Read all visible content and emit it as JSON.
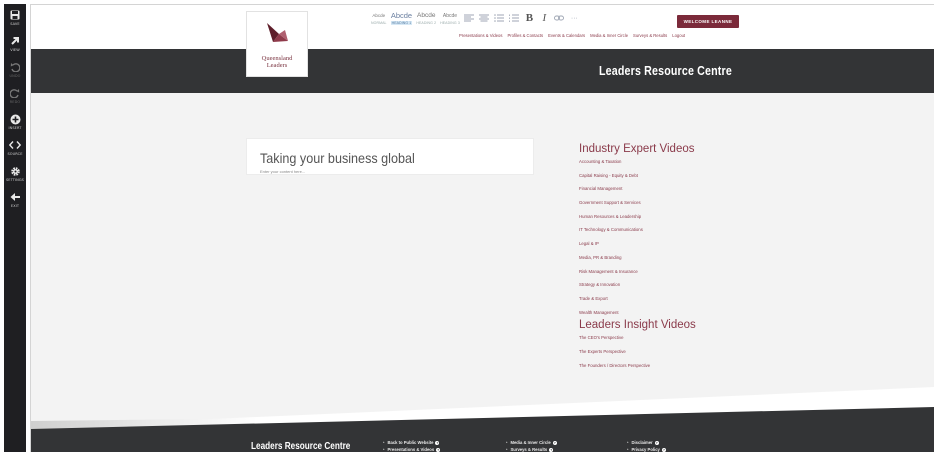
{
  "editor_toolbar": {
    "items": [
      {
        "label": "Save",
        "icon": "save-icon"
      },
      {
        "label": "View",
        "icon": "view-arrow-icon"
      },
      {
        "label": "Undo",
        "icon": "undo-icon"
      },
      {
        "label": "Redo",
        "icon": "redo-icon"
      },
      {
        "label": "Insert",
        "icon": "insert-plus-icon"
      },
      {
        "label": "Source",
        "icon": "source-code-icon"
      },
      {
        "label": "Settings",
        "icon": "gear-icon"
      },
      {
        "label": "Exit",
        "icon": "exit-arrow-icon"
      }
    ]
  },
  "logo": {
    "line1": "Queensland",
    "line2": "Leaders"
  },
  "format_toolbar": {
    "styles": [
      {
        "sample": "Abcde",
        "name": "NORMAL"
      },
      {
        "sample": "Abcde",
        "name": "HEADING 1"
      },
      {
        "sample": "Abcde",
        "name": "HEADING 2"
      },
      {
        "sample": "Abcde",
        "name": "HEADING 3"
      }
    ],
    "bold": "B",
    "italic": "I",
    "more": "···"
  },
  "welcome_button": "WELCOME LEANNE",
  "top_nav": [
    "Presentations & Videos",
    "Profiles & Contacts",
    "Events & Calendars",
    "Media & Inner Circle",
    "Surveys & Results",
    "Logout"
  ],
  "banner_title": "Leaders Resource Centre",
  "content": {
    "title": "Taking your business global",
    "placeholder": "Enter your content here..."
  },
  "industry_videos": {
    "heading": "Industry Expert Videos",
    "items": [
      "Accounting & Taxation",
      "Capital Raising - Equity & Debt",
      "Financial Management",
      "Government Support & Services",
      "Human Resources & Leadership",
      "IT Technology & Communications",
      "Legal & IP",
      "Media, PR & Branding",
      "Risk Management & Insurance",
      "Strategy & Innovation",
      "Trade & Export",
      "Wealth Management"
    ]
  },
  "insight_videos": {
    "heading": "Leaders Insight Videos",
    "items": [
      "The CEO's Perspective",
      "The Experts Perspective",
      "The Founders / Directors Perspective"
    ]
  },
  "footer": {
    "title": "Leaders Resource Centre",
    "col1": [
      "Back to Public Website",
      "Presentations & Videos"
    ],
    "col2": [
      "Media & Inner Circle",
      "Surveys & Results"
    ],
    "col3": [
      "Disclaimer",
      "Privacy Policy"
    ]
  },
  "colors": {
    "accent": "#7b2a3a",
    "link": "#8a3a4a",
    "dark": "#333436",
    "toolbar": "#1f1f22"
  }
}
